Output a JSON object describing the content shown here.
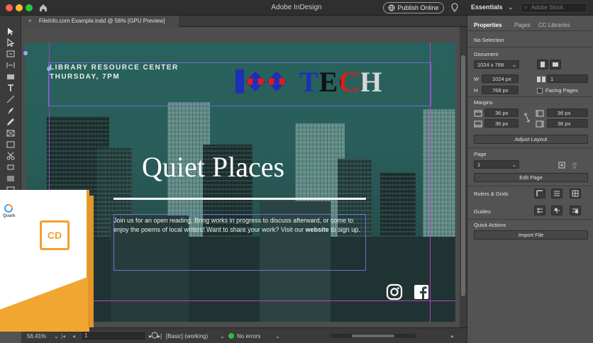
{
  "app": {
    "title": "Adobe InDesign",
    "publish_label": "Publish Online",
    "workspace": "Essentials",
    "search_placeholder": "Adobe Stock"
  },
  "document_tab": {
    "title": "FileInfo.com Example.indd @ 56% [GPU Preview]",
    "close_glyph": "×"
  },
  "page": {
    "header_line1": "LIBRARY RESOURCE CENTER",
    "header_line2": "THURSDAY, 7PM",
    "logo_text": "TECH",
    "headline": "Quiet Places",
    "body_pre": "Join us for an open reading. Bring works in progress to discuss afterward, or come to enjoy the poems of local writers! Want to share your work? Visit our",
    "body_link": "website",
    "body_post": "to sign up."
  },
  "status_bar": {
    "zoom": "56.41%",
    "page_number": "1",
    "style": "[Basic] (working)",
    "preflight": "No errors"
  },
  "panel": {
    "tabs": [
      {
        "label": "Properties",
        "active": true
      },
      {
        "label": "Pages",
        "active": false
      },
      {
        "label": "CC Libraries",
        "active": false
      }
    ],
    "selection": "No Selection",
    "document_label": "Document",
    "preset": "1024 x 768",
    "width_label": "W",
    "width": "1024 px",
    "height_label": "H",
    "height": "768 px",
    "pages_count": "1",
    "facing_pages": "Facing Pages",
    "margins_label": "Margins",
    "margin_top": "36 px",
    "margin_bottom": "36 px",
    "margin_left": "36 px",
    "margin_right": "36 px",
    "adjust_layout": "Adjust Layout",
    "page_label": "Page",
    "page_value": "1",
    "edit_page": "Edit Page",
    "rulers_grids": "Rulers & Grids",
    "guides": "Guides",
    "quick_actions": "Quick Actions",
    "import_file": "Import File"
  },
  "overlay": {
    "brand": "Quark",
    "product": "CD"
  },
  "colors": {
    "accent_guides": "#c13cc8",
    "frame_edges": "#6f6fd6",
    "teal_overlay": "#2f7a70",
    "quark_orange": "#f1a631"
  },
  "icons": [
    "home-icon",
    "lightbulb-icon",
    "search-icon",
    "selection-tool-icon",
    "type-tool-icon",
    "instagram-icon",
    "facebook-icon",
    "link-icon"
  ]
}
